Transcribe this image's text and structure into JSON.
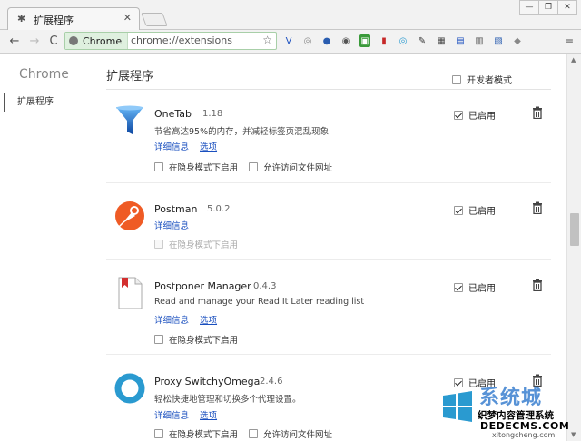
{
  "tab": {
    "title": "扩展程序",
    "close": "✕"
  },
  "window": {
    "minimize": "—",
    "maximize": "❐",
    "close": "✕"
  },
  "toolbar": {
    "back": "←",
    "forward": "→",
    "reload": "C",
    "chip_label": "Chrome",
    "url": "chrome://extensions",
    "star": "☆",
    "menu": "≡"
  },
  "ext_toolbar_icons": [
    {
      "glyph": "V",
      "color": "#1a4fbf",
      "bg": "transparent"
    },
    {
      "glyph": "◎",
      "color": "#888",
      "bg": "transparent"
    },
    {
      "glyph": "●",
      "color": "#2a5db0",
      "bg": "transparent"
    },
    {
      "glyph": "◉",
      "color": "#555",
      "bg": "transparent"
    },
    {
      "glyph": "▣",
      "color": "#fff",
      "bg": "#3a9a3a"
    },
    {
      "glyph": "▮",
      "color": "#c62828",
      "bg": "transparent"
    },
    {
      "glyph": "◎",
      "color": "#2a9ad0",
      "bg": "transparent"
    },
    {
      "glyph": "✎",
      "color": "#333",
      "bg": "transparent"
    },
    {
      "glyph": "▦",
      "color": "#444",
      "bg": "transparent"
    },
    {
      "glyph": "▤",
      "color": "#1a4fbf",
      "bg": "transparent"
    },
    {
      "glyph": "▥",
      "color": "#555",
      "bg": "transparent"
    },
    {
      "glyph": "▧",
      "color": "#2a5db0",
      "bg": "transparent"
    },
    {
      "glyph": "◆",
      "color": "#888",
      "bg": "transparent"
    }
  ],
  "sidebar": {
    "title": "Chrome",
    "item": "扩展程序"
  },
  "page": {
    "title": "扩展程序",
    "dev_mode": "开发者模式"
  },
  "extensions": [
    {
      "name": "OneTab",
      "version": "1.18",
      "description": "节省高达95%的内存，并减轻标签页混乱现象",
      "details": "详细信息",
      "options": "选项",
      "incognito": "在隐身模式下启用",
      "file_access": "允许访问文件网址",
      "enabled_label": "已启用"
    },
    {
      "name": "Postman",
      "version": "5.0.2",
      "details": "详细信息",
      "incognito": "在隐身模式下启用",
      "enabled_label": "已启用"
    },
    {
      "name": "Postponer Manager",
      "version": "0.4.3",
      "description": "Read and manage your Read It Later reading list",
      "details": "详细信息",
      "options": "选项",
      "incognito": "在隐身模式下启用",
      "enabled_label": "已启用"
    },
    {
      "name": "Proxy SwitchyOmega",
      "version": "2.4.6",
      "description": "轻松快捷地管理和切换多个代理设置。",
      "details": "详细信息",
      "options": "选项",
      "incognito": "在隐身模式下启用",
      "file_access": "允许访问文件网址",
      "enabled_label": "已启用"
    }
  ],
  "watermark": {
    "big": "系统城",
    "mid": "织梦内容管理系统",
    "domain": "DEDECMS.COM",
    "sub": "xitongcheng.com"
  },
  "colors": {
    "link": "#1a4fbf",
    "accent_green": "#dff0df",
    "postman_orange": "#ef5b25",
    "omega_blue": "#2a9ad0",
    "onetab_blue": "#1e88e5"
  }
}
